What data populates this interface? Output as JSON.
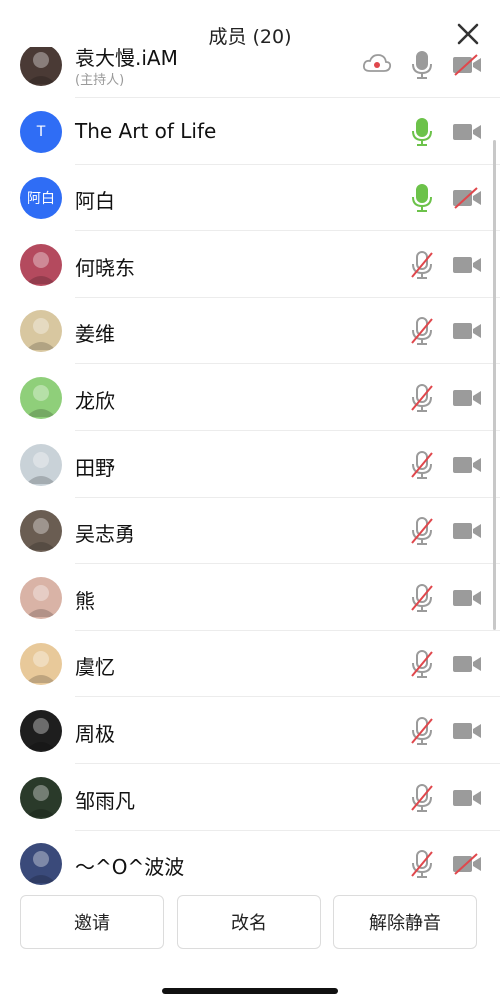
{
  "header": {
    "title": "成员 (20)"
  },
  "members": [
    {
      "name": "袁大慢.iAM",
      "role": "(主持人)",
      "avatar": {
        "type": "photo",
        "color": "#4a3a35"
      },
      "cloud": true,
      "mic": "gray",
      "cam": "off"
    },
    {
      "name": "The Art of Life",
      "avatar": {
        "type": "letter",
        "text": "T",
        "color": "#2f6df5"
      },
      "mic": "green",
      "cam": "on"
    },
    {
      "name": "阿白",
      "avatar": {
        "type": "letter",
        "text": "阿白",
        "color": "#2f6df5"
      },
      "mic": "green",
      "cam": "off"
    },
    {
      "name": "何晓东",
      "avatar": {
        "type": "photo",
        "color": "#b44a5e"
      },
      "mic": "muted",
      "cam": "on"
    },
    {
      "name": "姜维",
      "avatar": {
        "type": "photo",
        "color": "#d8c7a0"
      },
      "mic": "muted",
      "cam": "on"
    },
    {
      "name": "龙欣",
      "avatar": {
        "type": "photo",
        "color": "#8fcf7a"
      },
      "mic": "muted",
      "cam": "on"
    },
    {
      "name": "田野",
      "avatar": {
        "type": "photo",
        "color": "#c9d2d8"
      },
      "mic": "muted",
      "cam": "on"
    },
    {
      "name": "吴志勇",
      "avatar": {
        "type": "photo",
        "color": "#6a5d52"
      },
      "mic": "muted",
      "cam": "on"
    },
    {
      "name": "熊",
      "avatar": {
        "type": "photo",
        "color": "#d9b3a6"
      },
      "mic": "muted",
      "cam": "on"
    },
    {
      "name": "虞忆",
      "avatar": {
        "type": "photo",
        "color": "#e8c99a"
      },
      "mic": "muted",
      "cam": "on"
    },
    {
      "name": "周极",
      "avatar": {
        "type": "photo",
        "color": "#1e1e1e"
      },
      "mic": "muted",
      "cam": "on"
    },
    {
      "name": "邹雨凡",
      "avatar": {
        "type": "photo",
        "color": "#2a3a2a"
      },
      "mic": "muted",
      "cam": "on"
    },
    {
      "name": "～^O^波波",
      "avatar": {
        "type": "photo",
        "color": "#3a4a7a"
      },
      "mic": "muted",
      "cam": "off"
    }
  ],
  "actions": {
    "invite": "邀请",
    "rename": "改名",
    "unmute_all": "解除静音"
  },
  "colors": {
    "accent": "#2f6df5",
    "mic_active": "#6cc24a",
    "muted_slash": "#e0474c",
    "icon_gray": "#9b9b9b"
  },
  "icons": {
    "close": "close-icon",
    "cloud": "cloud-record-icon",
    "mic": "microphone-icon",
    "cam": "camera-icon"
  }
}
